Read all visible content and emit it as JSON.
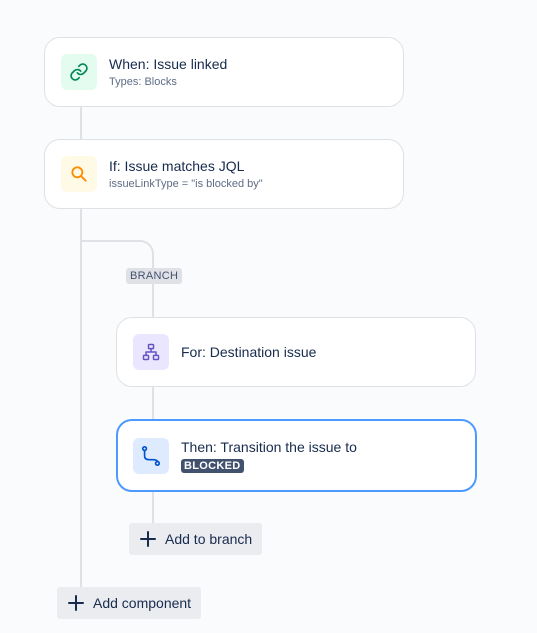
{
  "trigger": {
    "title": "When: Issue linked",
    "subtitle": "Types: Blocks",
    "icon": "link-icon",
    "icon_bg": "#e3fcef",
    "icon_color": "#00875a"
  },
  "condition": {
    "title": "If: Issue matches JQL",
    "subtitle": "issueLinkType = \"is blocked by\"",
    "icon": "search-icon",
    "icon_bg": "#fffae6",
    "icon_color": "#ff8b00"
  },
  "branch": {
    "label": "BRANCH"
  },
  "branch_rule": {
    "title": "For: Destination issue",
    "icon": "hierarchy-icon",
    "icon_bg": "#eae6ff",
    "icon_color": "#6554c0"
  },
  "action": {
    "title": "Then: Transition the issue to",
    "status_lozenge": "BLOCKED",
    "icon": "transition-icon",
    "icon_bg": "#deebff",
    "icon_color": "#0052cc"
  },
  "buttons": {
    "add_to_branch": "Add to branch",
    "add_component": "Add component"
  },
  "colors": {
    "selected_border": "#4c9aff",
    "connector": "#dfe1e6"
  }
}
